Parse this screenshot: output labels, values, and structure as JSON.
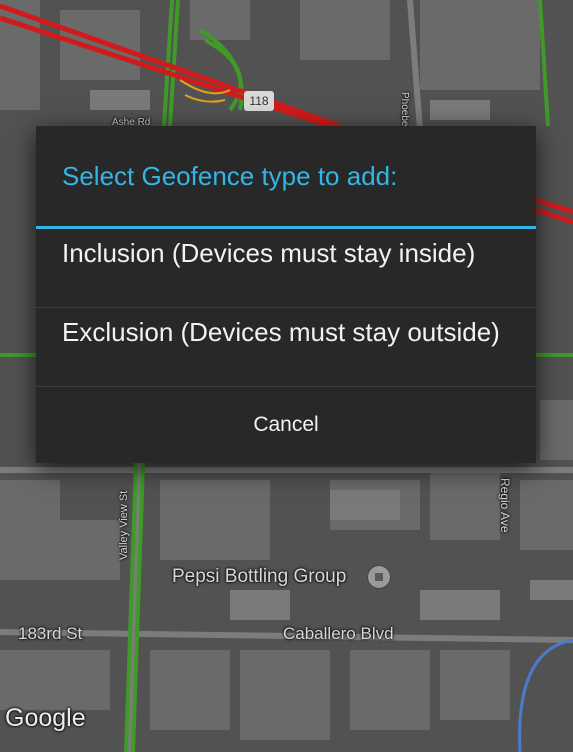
{
  "dialog": {
    "title": "Select Geofence type to add:",
    "options": [
      {
        "label": "Inclusion (Devices must stay inside)"
      },
      {
        "label": "Exclusion (Devices must stay outside)"
      }
    ],
    "cancel_label": "Cancel"
  },
  "map": {
    "labels": {
      "poi": "Pepsi Bottling Group",
      "street_183rd": "183rd St",
      "street_caballero": "Caballero Blvd",
      "street_valley_view": "Valley View St",
      "street_regio": "Regio Ave",
      "street_phoebe": "Phoebe",
      "street_ashe": "Ashe Rd"
    },
    "route_shield": "118",
    "provider_logo": "Google"
  },
  "colors": {
    "accent": "#33b5e5",
    "dialog_bg": "#282828",
    "traffic_red": "#d11b1b",
    "traffic_green": "#3f9a2a"
  }
}
